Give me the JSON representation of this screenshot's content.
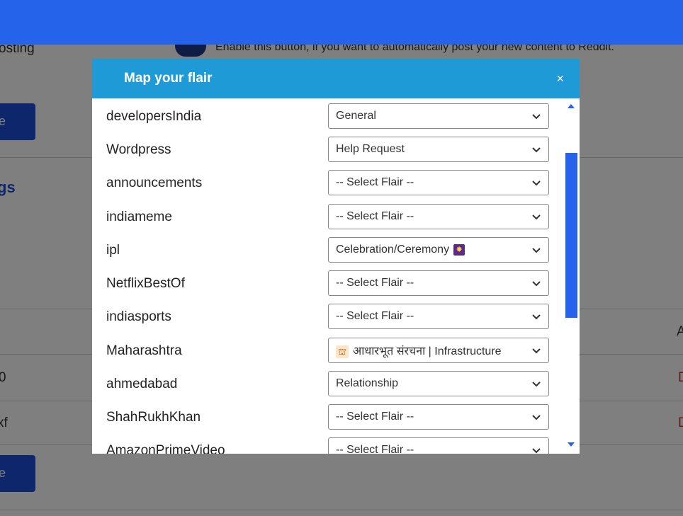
{
  "background": {
    "posting_label": "osting",
    "toggle_text": "Enable this button, if you want to automatically post your new content to Reddit.",
    "heading_partial": "gs",
    "button_partial": "e",
    "table_cell_1": "0",
    "table_cell_2": "xf",
    "header_partial": "A",
    "action_partial": "D"
  },
  "modal": {
    "title": "Map your flair",
    "close_label": "×",
    "rows": [
      {
        "subreddit": "developersIndia",
        "flair": "General"
      },
      {
        "subreddit": "Wordpress",
        "flair": "Help Request"
      },
      {
        "subreddit": "announcements",
        "flair": "-- Select Flair --"
      },
      {
        "subreddit": "indiameme",
        "flair": "-- Select Flair --"
      },
      {
        "subreddit": "ipl",
        "flair": "Celebration/Ceremony",
        "flair_emoji": "✸"
      },
      {
        "subreddit": "NetflixBestOf",
        "flair": "-- Select Flair --"
      },
      {
        "subreddit": "indiasports",
        "flair": "-- Select Flair --"
      },
      {
        "subreddit": "Maharashtra",
        "flair": "आधारभूत संरचना | Infrastructure",
        "flair_emoji_lead": "⛫"
      },
      {
        "subreddit": "ahmedabad",
        "flair": "Relationship"
      },
      {
        "subreddit": "ShahRukhKhan",
        "flair": "-- Select Flair --"
      },
      {
        "subreddit": "AmazonPrimeVideo",
        "flair": "-- Select Flair --"
      }
    ]
  },
  "colors": {
    "topbar": "#2563eb",
    "modal_header": "#1e9bd7",
    "scroll_thumb": "#2563eb"
  }
}
